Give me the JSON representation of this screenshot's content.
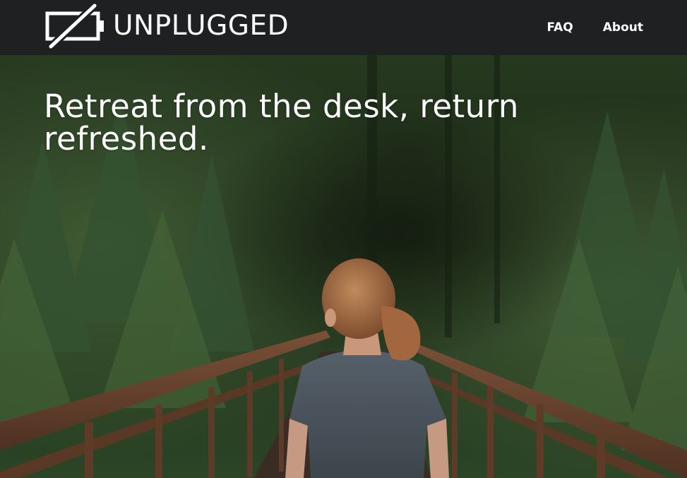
{
  "brand": {
    "name": "UNPLUGGED",
    "logo_icon": "unplugged-battery-icon"
  },
  "nav": {
    "items": [
      {
        "label": "FAQ"
      },
      {
        "label": "About"
      }
    ]
  },
  "hero": {
    "headline": "Retreat from the desk, return refreshed."
  },
  "colors": {
    "header_bg": "#1f2021",
    "text": "#ffffff",
    "forest_dark": "#1c2a1a",
    "forest_mid": "#2f4a2b",
    "bridge_rust": "#6e4733",
    "shirt": "#4b545b",
    "hair": "#a36a43"
  }
}
